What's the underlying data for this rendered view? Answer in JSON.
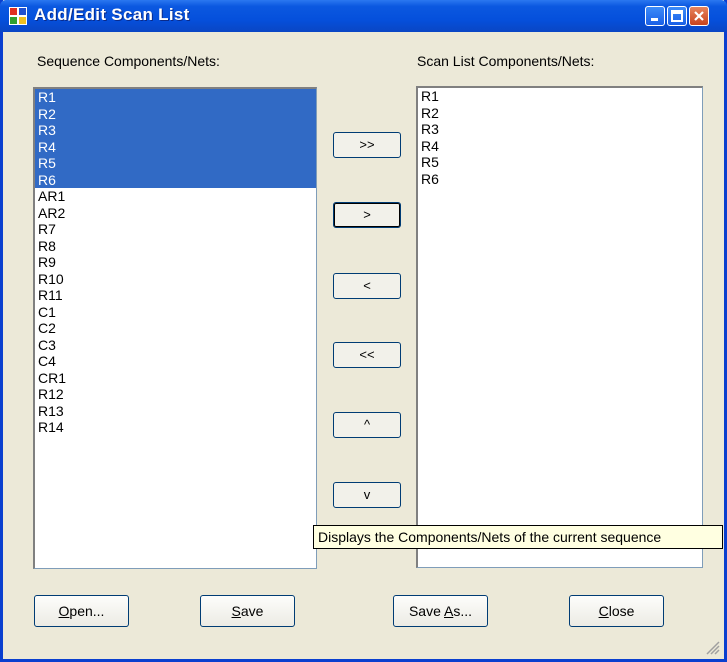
{
  "window": {
    "title": "Add/Edit Scan List",
    "buttons": [
      "minimize",
      "maximize",
      "close"
    ]
  },
  "left_panel": {
    "label": "Sequence Components/Nets:",
    "items": [
      "R1",
      "R2",
      "R3",
      "R4",
      "R5",
      "R6",
      "AR1",
      "AR2",
      "R7",
      "R8",
      "R9",
      "R10",
      "R11",
      "C1",
      "C2",
      "C3",
      "C4",
      "CR1",
      "R12",
      "R13",
      "R14"
    ],
    "selected": [
      "R1",
      "R2",
      "R3",
      "R4",
      "R5",
      "R6"
    ]
  },
  "right_panel": {
    "label": "Scan List Components/Nets:",
    "items": [
      "R1",
      "R2",
      "R3",
      "R4",
      "R5",
      "R6"
    ]
  },
  "move_buttons": {
    "add_all": ">>",
    "add": ">",
    "remove": "<",
    "remove_all": "<<",
    "move_up": "^",
    "move_down": "v"
  },
  "tooltip": "Displays the Components/Nets of the current sequence",
  "footer": {
    "open_label": "Open...",
    "save_label": "Save",
    "save_as_label": "Save As...",
    "close_label": "Close"
  },
  "colors": {
    "selection": "#316ac5",
    "titlebar": "#0550dc",
    "window_bg": "#ece9d8"
  }
}
